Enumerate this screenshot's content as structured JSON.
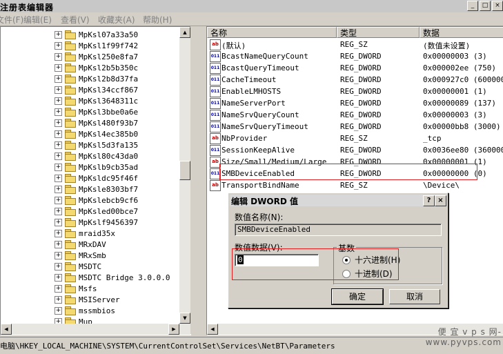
{
  "window": {
    "title": "注册表编辑器",
    "btn_min": "_",
    "btn_max": "□",
    "btn_close": "×"
  },
  "menu": [
    "文件(F)",
    "编辑(E)",
    "查看(V)",
    "收藏夹(A)",
    "帮助(H)"
  ],
  "tree": {
    "expand_glyph": "+",
    "items": [
      "MpKsl07a33a50",
      "MpKsl1f99f742",
      "MpKsl250e8fa7",
      "MpKsl2b5b350c",
      "MpKsl2b8d37fa",
      "MpKsl34ccf867",
      "MpKsl3648311c",
      "MpKsl3bbe0a6e",
      "MpKsl480f93b7",
      "MpKsl4ec385b0",
      "MpKsl5d3fa135",
      "MpKsl80c43da0",
      "MpKslb9cb35ad",
      "MpKsldc95f46f",
      "MpKsle8303bf7",
      "MpKslebcb9cf6",
      "MpKsled00bce7",
      "MpKslf9456397",
      "mraid35x",
      "MRxDAV",
      "MRxSmb",
      "MSDTC",
      "MSDTC Bridge 3.0.0.0",
      "Msfs",
      "MSIServer",
      "mssmbios",
      "Mup"
    ]
  },
  "list": {
    "columns": [
      "名称",
      "类型",
      "数据"
    ],
    "rows": [
      {
        "icon": "ab",
        "name": "(默认)",
        "type": "REG_SZ",
        "data": "(数值未设置)"
      },
      {
        "icon": "dw",
        "name": "BcastNameQueryCount",
        "type": "REG_DWORD",
        "data": "0x00000003 (3)"
      },
      {
        "icon": "dw",
        "name": "BcastQueryTimeout",
        "type": "REG_DWORD",
        "data": "0x000002ee (750)"
      },
      {
        "icon": "dw",
        "name": "CacheTimeout",
        "type": "REG_DWORD",
        "data": "0x000927c0 (600000)"
      },
      {
        "icon": "dw",
        "name": "EnableLMHOSTS",
        "type": "REG_DWORD",
        "data": "0x00000001 (1)"
      },
      {
        "icon": "dw",
        "name": "NameServerPort",
        "type": "REG_DWORD",
        "data": "0x00000089 (137)"
      },
      {
        "icon": "dw",
        "name": "NameSrvQueryCount",
        "type": "REG_DWORD",
        "data": "0x00000003 (3)"
      },
      {
        "icon": "dw",
        "name": "NameSrvQueryTimeout",
        "type": "REG_DWORD",
        "data": "0x00000bb8 (3000)"
      },
      {
        "icon": "ab",
        "name": "NbProvider",
        "type": "REG_SZ",
        "data": "_tcp"
      },
      {
        "icon": "dw",
        "name": "SessionKeepAlive",
        "type": "REG_DWORD",
        "data": "0x0036ee80 (3600000"
      },
      {
        "icon": "ab",
        "name": "Size/Small/Medium/Large",
        "type": "REG_DWORD",
        "data": "0x00000001 (1)"
      },
      {
        "icon": "dw",
        "name": "SMBDeviceEnabled",
        "type": "REG_DWORD",
        "data": "0x00000000 (0)"
      },
      {
        "icon": "ab",
        "name": "TransportBindName",
        "type": "REG_SZ",
        "data": "\\Device\\"
      }
    ]
  },
  "dialog": {
    "title": "编辑 DWORD 值",
    "help_btn": "?",
    "close_btn": "×",
    "name_label": "数值名称(N):",
    "name_value": "SMBDeviceEnabled",
    "data_label": "数值数据(V):",
    "data_value": "0",
    "base_label": "基数",
    "radio_hex": "十六进制(H)",
    "radio_dec": "十进制(D)",
    "hex_selected": true,
    "ok": "确定",
    "cancel": "取消"
  },
  "status": {
    "path": "电脑\\HKEY_LOCAL_MACHINE\\SYSTEM\\CurrentControlSet\\Services\\NetBT\\Parameters"
  },
  "watermark": {
    "line1": "便 宜 v p s 网-",
    "line2": "www.pyvps.com"
  },
  "colors": {
    "highlight_box": "#e02020",
    "menu_text": "#808080"
  }
}
